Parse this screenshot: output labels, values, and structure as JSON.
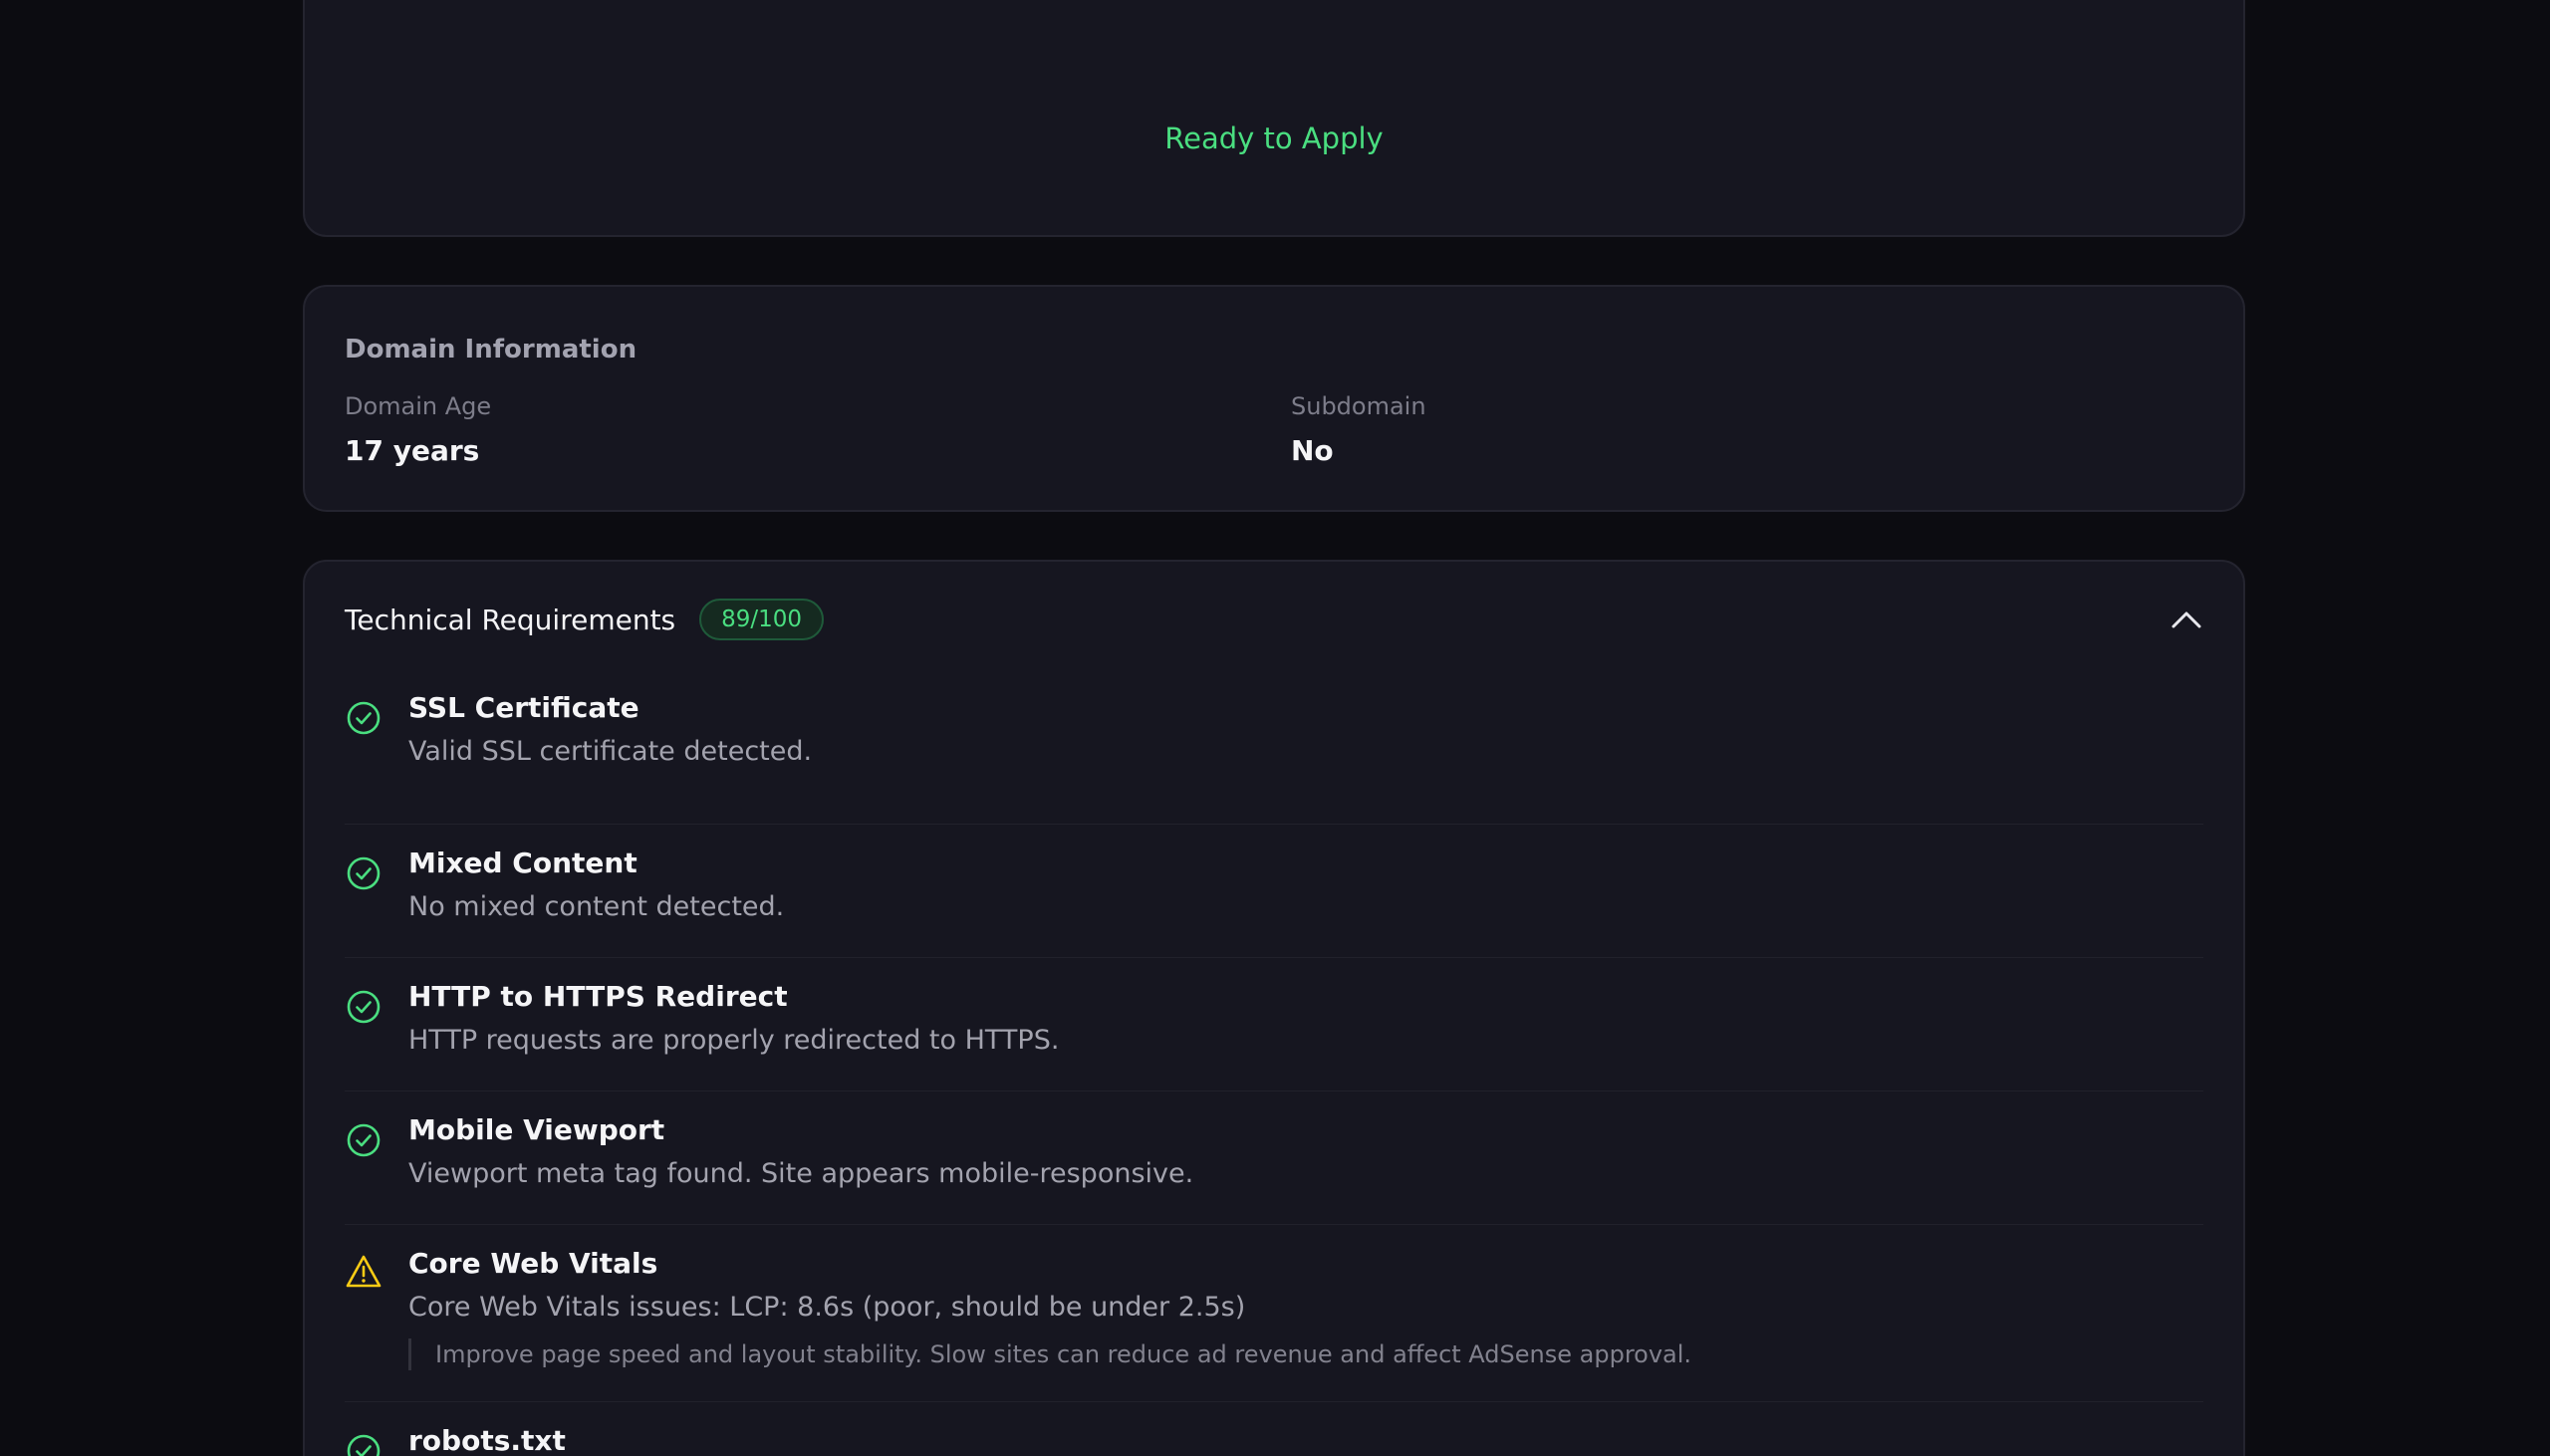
{
  "score": {
    "status": "Ready to Apply",
    "accent_color": "#4ade80"
  },
  "domain_info": {
    "heading": "Domain Information",
    "domain_age_label": "Domain Age",
    "domain_age_value": "17 years",
    "subdomain_label": "Subdomain",
    "subdomain_value": "No"
  },
  "technical": {
    "title": "Technical Requirements",
    "score_badge": "89/100",
    "toggle_icon": "chevron-up-icon",
    "items": [
      {
        "status": "pass",
        "title": "SSL Certificate",
        "description": "Valid SSL certificate detected."
      },
      {
        "status": "pass",
        "title": "Mixed Content",
        "description": "No mixed content detected."
      },
      {
        "status": "pass",
        "title": "HTTP to HTTPS Redirect",
        "description": "HTTP requests are properly redirected to HTTPS."
      },
      {
        "status": "pass",
        "title": "Mobile Viewport",
        "description": "Viewport meta tag found. Site appears mobile-responsive."
      },
      {
        "status": "warning",
        "title": "Core Web Vitals",
        "description": "Core Web Vitals issues: LCP: 8.6s (poor, should be under 2.5s)",
        "note": "Improve page speed and layout stability. Slow sites can reduce ad revenue and affect AdSense approval."
      },
      {
        "status": "pass",
        "title": "robots.txt",
        "description": ""
      }
    ]
  },
  "colors": {
    "pass": "#4ade80",
    "warning": "#facc15",
    "background": "#0c0c11",
    "card": "#161620"
  }
}
